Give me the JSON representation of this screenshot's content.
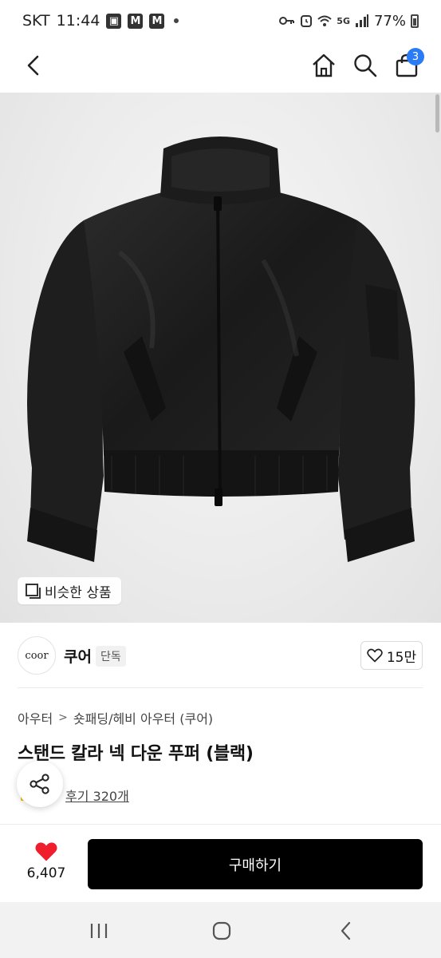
{
  "status_bar": {
    "carrier": "SKT",
    "time": "11:44",
    "network": "5G",
    "battery": "77%",
    "icons": [
      "gallery-icon",
      "m-icon",
      "m-icon",
      "notification-dot",
      "key-icon",
      "alarm-icon",
      "wifi-icon",
      "signal-icon",
      "battery-icon"
    ]
  },
  "header": {
    "icons": [
      "back-arrow-icon",
      "home-icon",
      "search-icon",
      "cart-icon"
    ],
    "cart_badge": "3"
  },
  "hero": {
    "image_desc_icon": "black-bomber-jacket-image",
    "similar_chip_label": "비슷한 상품"
  },
  "brand": {
    "logo_text": "coor",
    "name": "쿠어",
    "tag": "단독",
    "like_count": "15만"
  },
  "product": {
    "breadcrumb": [
      "아우터",
      "숏패딩/헤비 아우터 (쿠어)"
    ],
    "title": "스탠드 칼라 넥 다운 푸퍼 (블랙)",
    "review_label": "후기 320개"
  },
  "buy_bar": {
    "heart_count": "6,407",
    "buy_label": "구매하기",
    "heart_color": "#f01e2c"
  },
  "nav": {
    "icons": [
      "recents-icon",
      "home-circle-icon",
      "back-icon"
    ]
  }
}
